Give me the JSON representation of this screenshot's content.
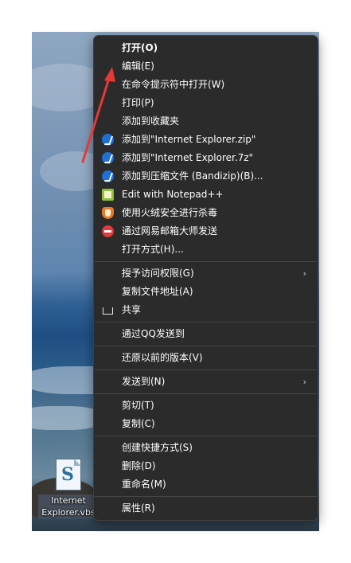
{
  "desktop": {
    "file": {
      "name": "Internet\nExplorer.vbs",
      "icon": "vbs-script-icon"
    }
  },
  "context_menu": {
    "groups": [
      [
        {
          "label": "打开(O)",
          "bold": true
        },
        {
          "label": "编辑(E)"
        },
        {
          "label": "在命令提示符中打开(W)"
        },
        {
          "label": "打印(P)"
        },
        {
          "label": "添加到收藏夹"
        },
        {
          "label": "添加到\"Internet Explorer.zip\"",
          "icon": "bandizip-icon"
        },
        {
          "label": "添加到\"Internet Explorer.7z\"",
          "icon": "bandizip-icon"
        },
        {
          "label": "添加到压缩文件 (Bandizip)(B)...",
          "icon": "bandizip-icon"
        },
        {
          "label": "Edit with Notepad++",
          "icon": "notepadpp-icon"
        },
        {
          "label": "使用火绒安全进行杀毒",
          "icon": "huorong-icon"
        },
        {
          "label": "通过网易邮箱大师发送",
          "icon": "netease-mail-icon"
        },
        {
          "label": "打开方式(H)..."
        }
      ],
      [
        {
          "label": "授予访问权限(G)",
          "submenu": true
        },
        {
          "label": "复制文件地址(A)"
        },
        {
          "label": "共享",
          "icon": "share-icon"
        }
      ],
      [
        {
          "label": "通过QQ发送到"
        }
      ],
      [
        {
          "label": "还原以前的版本(V)"
        }
      ],
      [
        {
          "label": "发送到(N)",
          "submenu": true
        }
      ],
      [
        {
          "label": "剪切(T)"
        },
        {
          "label": "复制(C)"
        }
      ],
      [
        {
          "label": "创建快捷方式(S)"
        },
        {
          "label": "删除(D)"
        },
        {
          "label": "重命名(M)"
        }
      ],
      [
        {
          "label": "属性(R)"
        }
      ]
    ]
  },
  "annotation": {
    "color": "#e53935",
    "points_to": "编辑(E)"
  }
}
